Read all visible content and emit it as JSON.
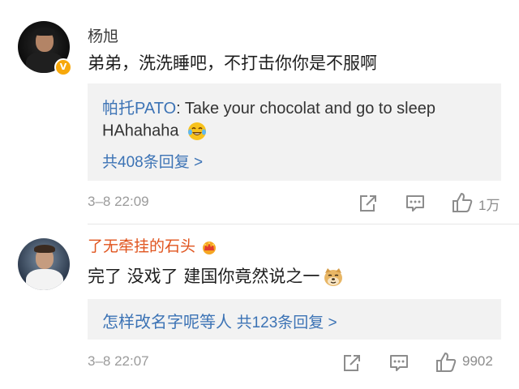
{
  "comments": [
    {
      "username": "杨旭",
      "verified": true,
      "text": "弟弟，洗洗睡吧，不打击你你是不服啊",
      "reply": {
        "author": "帕托PATO",
        "separator": ":",
        "line1": " Take your chocolat and go to sleep",
        "line2": "HAhahaha",
        "emoji": "laughing-tears-emoji",
        "count_text": "共408条回复 >"
      },
      "time": "3–8 22:09",
      "likes": "1万"
    },
    {
      "username": "了无牵挂的石头",
      "badge": "crown-icon",
      "text": "完了 没戏了 建国你竟然说之一",
      "emoji": "doge-emoji",
      "reply": {
        "author": "怎样改名字呢等人",
        "count_text": "共123条回复 >"
      },
      "time": "3–8 22:07",
      "likes": "9902"
    }
  ],
  "colors": {
    "link_blue": "#3c73b5",
    "vip_orange": "#e0541e",
    "verified_badge": "#f7a80b",
    "reply_bg": "#f2f2f2",
    "meta_gray": "#9b9b9b"
  }
}
